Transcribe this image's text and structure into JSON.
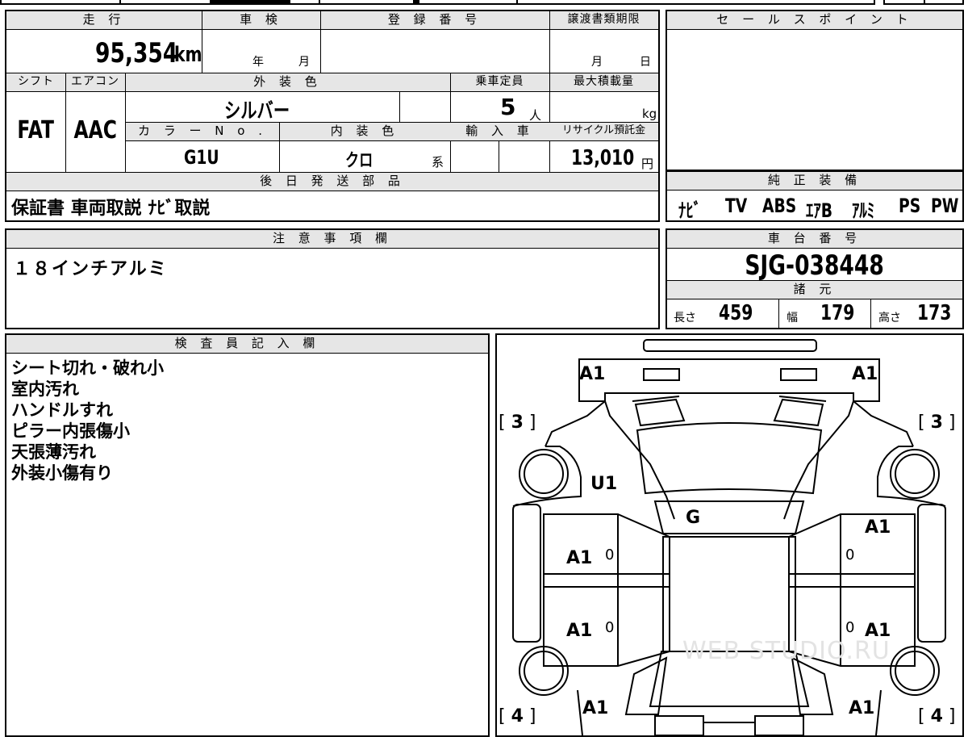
{
  "main_table": {
    "mileage_label": "走 行",
    "mileage_value": "95,354",
    "mileage_unit": "km",
    "shaken_label": "車 検",
    "shaken_year": "年",
    "shaken_month": "月",
    "reg_label": "登 録 番 号",
    "transfer_label": "譲渡書類期限",
    "transfer_month": "月",
    "transfer_day": "日",
    "shift_label": "シフト",
    "shift_value": "FAT",
    "ac_label": "エアコン",
    "ac_value": "AAC",
    "ext_color_label": "外 装 色",
    "ext_color_value": "シルバー",
    "capacity_label": "乗車定員",
    "capacity_value": "5",
    "capacity_unit": "人",
    "maxload_label": "最大積載量",
    "maxload_unit": "kg",
    "color_no_label": "カ ラ ー N o .",
    "color_no_value": "G1U",
    "int_color_label": "内 装 色",
    "int_color_value": "クロ",
    "int_color_suffix": "系",
    "import_label": "輸 入 車",
    "recycle_label": "リサイクル預託金",
    "recycle_value": "13,010",
    "recycle_unit": "円",
    "later_parts_label": "後 日 発 送 部 品",
    "later_parts_value": "保証書 車両取説 ﾅﾋﾞ取説"
  },
  "sales_point": {
    "label": "セ ー ル ス ポ イ ン ト"
  },
  "equipment": {
    "label": "純 正 装 備",
    "items": [
      "ﾅﾋﾞ",
      "TV",
      "ABS",
      "ｴｱB",
      "ｱﾙﾐ",
      "PS",
      "PW"
    ]
  },
  "notes": {
    "label": "注 意 事 項 欄",
    "value": "１８インチアルミ"
  },
  "chassis": {
    "label": "車 台 番 号",
    "value": "SJG-038448",
    "spec_label": "諸 元",
    "length_label": "長さ",
    "length_value": "459",
    "width_label": "幅",
    "width_value": "179",
    "height_label": "高さ",
    "height_value": "173"
  },
  "inspector": {
    "label": "検 査 員 記 入 欄",
    "lines": [
      "シート切れ・破れ小",
      "室内汚れ",
      "ハンドルすれ",
      "ピラー内張傷小",
      "天張薄汚れ",
      "外装小傷有り"
    ]
  },
  "diagram": {
    "front_left": "A1",
    "front_right": "A1",
    "bracket_left_top": "3",
    "bracket_right_top": "3",
    "bracket_left_bottom": "4",
    "bracket_right_bottom": "4",
    "pillar": "U1",
    "roof": "G",
    "right_front_door": "A1",
    "left_front_door": "A1",
    "left_rear_door": "A1",
    "right_rear_door": "A1",
    "rear_left": "A1",
    "rear_right": "A1",
    "door_marks": [
      "0",
      "0",
      "0",
      "0"
    ],
    "watermark": "WEB STUDIO.RU"
  }
}
